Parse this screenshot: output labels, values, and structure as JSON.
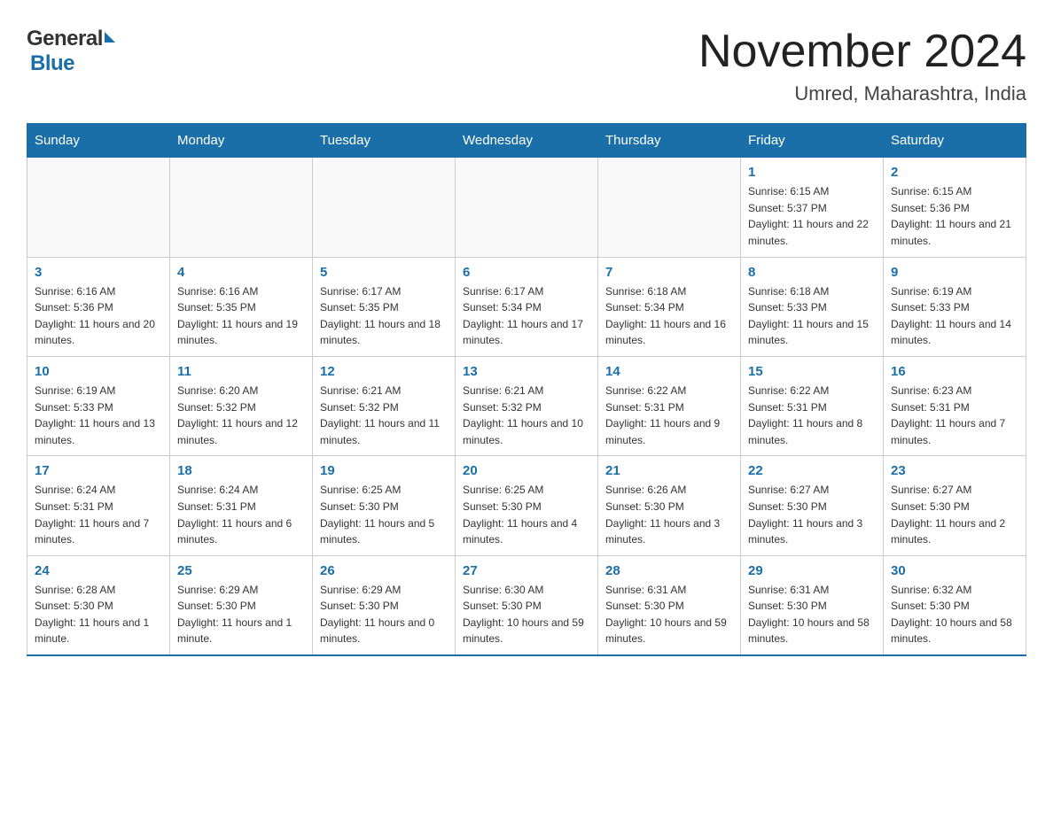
{
  "header": {
    "logo_general": "General",
    "logo_blue": "Blue",
    "month_title": "November 2024",
    "location": "Umred, Maharashtra, India"
  },
  "weekdays": [
    "Sunday",
    "Monday",
    "Tuesday",
    "Wednesday",
    "Thursday",
    "Friday",
    "Saturday"
  ],
  "weeks": [
    [
      {
        "day": "",
        "sunrise": "",
        "sunset": "",
        "daylight": ""
      },
      {
        "day": "",
        "sunrise": "",
        "sunset": "",
        "daylight": ""
      },
      {
        "day": "",
        "sunrise": "",
        "sunset": "",
        "daylight": ""
      },
      {
        "day": "",
        "sunrise": "",
        "sunset": "",
        "daylight": ""
      },
      {
        "day": "",
        "sunrise": "",
        "sunset": "",
        "daylight": ""
      },
      {
        "day": "1",
        "sunrise": "Sunrise: 6:15 AM",
        "sunset": "Sunset: 5:37 PM",
        "daylight": "Daylight: 11 hours and 22 minutes."
      },
      {
        "day": "2",
        "sunrise": "Sunrise: 6:15 AM",
        "sunset": "Sunset: 5:36 PM",
        "daylight": "Daylight: 11 hours and 21 minutes."
      }
    ],
    [
      {
        "day": "3",
        "sunrise": "Sunrise: 6:16 AM",
        "sunset": "Sunset: 5:36 PM",
        "daylight": "Daylight: 11 hours and 20 minutes."
      },
      {
        "day": "4",
        "sunrise": "Sunrise: 6:16 AM",
        "sunset": "Sunset: 5:35 PM",
        "daylight": "Daylight: 11 hours and 19 minutes."
      },
      {
        "day": "5",
        "sunrise": "Sunrise: 6:17 AM",
        "sunset": "Sunset: 5:35 PM",
        "daylight": "Daylight: 11 hours and 18 minutes."
      },
      {
        "day": "6",
        "sunrise": "Sunrise: 6:17 AM",
        "sunset": "Sunset: 5:34 PM",
        "daylight": "Daylight: 11 hours and 17 minutes."
      },
      {
        "day": "7",
        "sunrise": "Sunrise: 6:18 AM",
        "sunset": "Sunset: 5:34 PM",
        "daylight": "Daylight: 11 hours and 16 minutes."
      },
      {
        "day": "8",
        "sunrise": "Sunrise: 6:18 AM",
        "sunset": "Sunset: 5:33 PM",
        "daylight": "Daylight: 11 hours and 15 minutes."
      },
      {
        "day": "9",
        "sunrise": "Sunrise: 6:19 AM",
        "sunset": "Sunset: 5:33 PM",
        "daylight": "Daylight: 11 hours and 14 minutes."
      }
    ],
    [
      {
        "day": "10",
        "sunrise": "Sunrise: 6:19 AM",
        "sunset": "Sunset: 5:33 PM",
        "daylight": "Daylight: 11 hours and 13 minutes."
      },
      {
        "day": "11",
        "sunrise": "Sunrise: 6:20 AM",
        "sunset": "Sunset: 5:32 PM",
        "daylight": "Daylight: 11 hours and 12 minutes."
      },
      {
        "day": "12",
        "sunrise": "Sunrise: 6:21 AM",
        "sunset": "Sunset: 5:32 PM",
        "daylight": "Daylight: 11 hours and 11 minutes."
      },
      {
        "day": "13",
        "sunrise": "Sunrise: 6:21 AM",
        "sunset": "Sunset: 5:32 PM",
        "daylight": "Daylight: 11 hours and 10 minutes."
      },
      {
        "day": "14",
        "sunrise": "Sunrise: 6:22 AM",
        "sunset": "Sunset: 5:31 PM",
        "daylight": "Daylight: 11 hours and 9 minutes."
      },
      {
        "day": "15",
        "sunrise": "Sunrise: 6:22 AM",
        "sunset": "Sunset: 5:31 PM",
        "daylight": "Daylight: 11 hours and 8 minutes."
      },
      {
        "day": "16",
        "sunrise": "Sunrise: 6:23 AM",
        "sunset": "Sunset: 5:31 PM",
        "daylight": "Daylight: 11 hours and 7 minutes."
      }
    ],
    [
      {
        "day": "17",
        "sunrise": "Sunrise: 6:24 AM",
        "sunset": "Sunset: 5:31 PM",
        "daylight": "Daylight: 11 hours and 7 minutes."
      },
      {
        "day": "18",
        "sunrise": "Sunrise: 6:24 AM",
        "sunset": "Sunset: 5:31 PM",
        "daylight": "Daylight: 11 hours and 6 minutes."
      },
      {
        "day": "19",
        "sunrise": "Sunrise: 6:25 AM",
        "sunset": "Sunset: 5:30 PM",
        "daylight": "Daylight: 11 hours and 5 minutes."
      },
      {
        "day": "20",
        "sunrise": "Sunrise: 6:25 AM",
        "sunset": "Sunset: 5:30 PM",
        "daylight": "Daylight: 11 hours and 4 minutes."
      },
      {
        "day": "21",
        "sunrise": "Sunrise: 6:26 AM",
        "sunset": "Sunset: 5:30 PM",
        "daylight": "Daylight: 11 hours and 3 minutes."
      },
      {
        "day": "22",
        "sunrise": "Sunrise: 6:27 AM",
        "sunset": "Sunset: 5:30 PM",
        "daylight": "Daylight: 11 hours and 3 minutes."
      },
      {
        "day": "23",
        "sunrise": "Sunrise: 6:27 AM",
        "sunset": "Sunset: 5:30 PM",
        "daylight": "Daylight: 11 hours and 2 minutes."
      }
    ],
    [
      {
        "day": "24",
        "sunrise": "Sunrise: 6:28 AM",
        "sunset": "Sunset: 5:30 PM",
        "daylight": "Daylight: 11 hours and 1 minute."
      },
      {
        "day": "25",
        "sunrise": "Sunrise: 6:29 AM",
        "sunset": "Sunset: 5:30 PM",
        "daylight": "Daylight: 11 hours and 1 minute."
      },
      {
        "day": "26",
        "sunrise": "Sunrise: 6:29 AM",
        "sunset": "Sunset: 5:30 PM",
        "daylight": "Daylight: 11 hours and 0 minutes."
      },
      {
        "day": "27",
        "sunrise": "Sunrise: 6:30 AM",
        "sunset": "Sunset: 5:30 PM",
        "daylight": "Daylight: 10 hours and 59 minutes."
      },
      {
        "day": "28",
        "sunrise": "Sunrise: 6:31 AM",
        "sunset": "Sunset: 5:30 PM",
        "daylight": "Daylight: 10 hours and 59 minutes."
      },
      {
        "day": "29",
        "sunrise": "Sunrise: 6:31 AM",
        "sunset": "Sunset: 5:30 PM",
        "daylight": "Daylight: 10 hours and 58 minutes."
      },
      {
        "day": "30",
        "sunrise": "Sunrise: 6:32 AM",
        "sunset": "Sunset: 5:30 PM",
        "daylight": "Daylight: 10 hours and 58 minutes."
      }
    ]
  ]
}
